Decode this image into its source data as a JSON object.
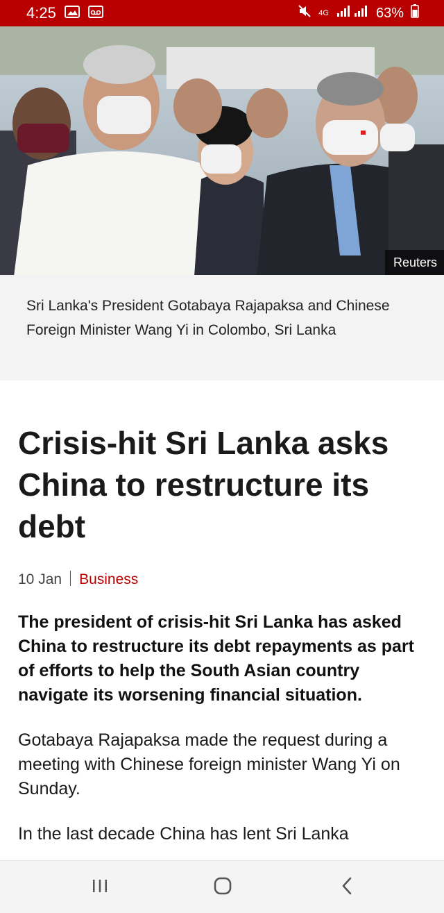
{
  "status_bar": {
    "time": "4:25",
    "network": "4G",
    "battery": "63%"
  },
  "hero": {
    "credit": "Reuters"
  },
  "caption": "Sri Lanka's President Gotabaya Rajapaksa and Chinese Foreign Minister Wang Yi in Colombo, Sri Lanka",
  "article": {
    "headline": "Crisis-hit Sri Lanka asks China to restructure its debt",
    "date": "10 Jan",
    "topic": "Business",
    "lead": "The president of crisis-hit Sri Lanka has asked China to restructure its debt repayments as part of efforts to help the South Asian country navigate its worsening financial situation.",
    "paragraphs": [
      "Gotabaya Rajapaksa made the request during a meeting with Chinese foreign minister Wang Yi on Sunday.",
      "In the last decade China has lent Sri Lanka"
    ]
  },
  "colors": {
    "brand": "#b80000",
    "caption_bg": "#f3f3f3",
    "nav_bg": "#f4f4f4"
  },
  "icons": [
    "gallery-icon",
    "voicemail-icon",
    "mute-icon",
    "signal-icon",
    "battery-icon",
    "recent-apps-icon",
    "home-icon",
    "back-icon"
  ]
}
